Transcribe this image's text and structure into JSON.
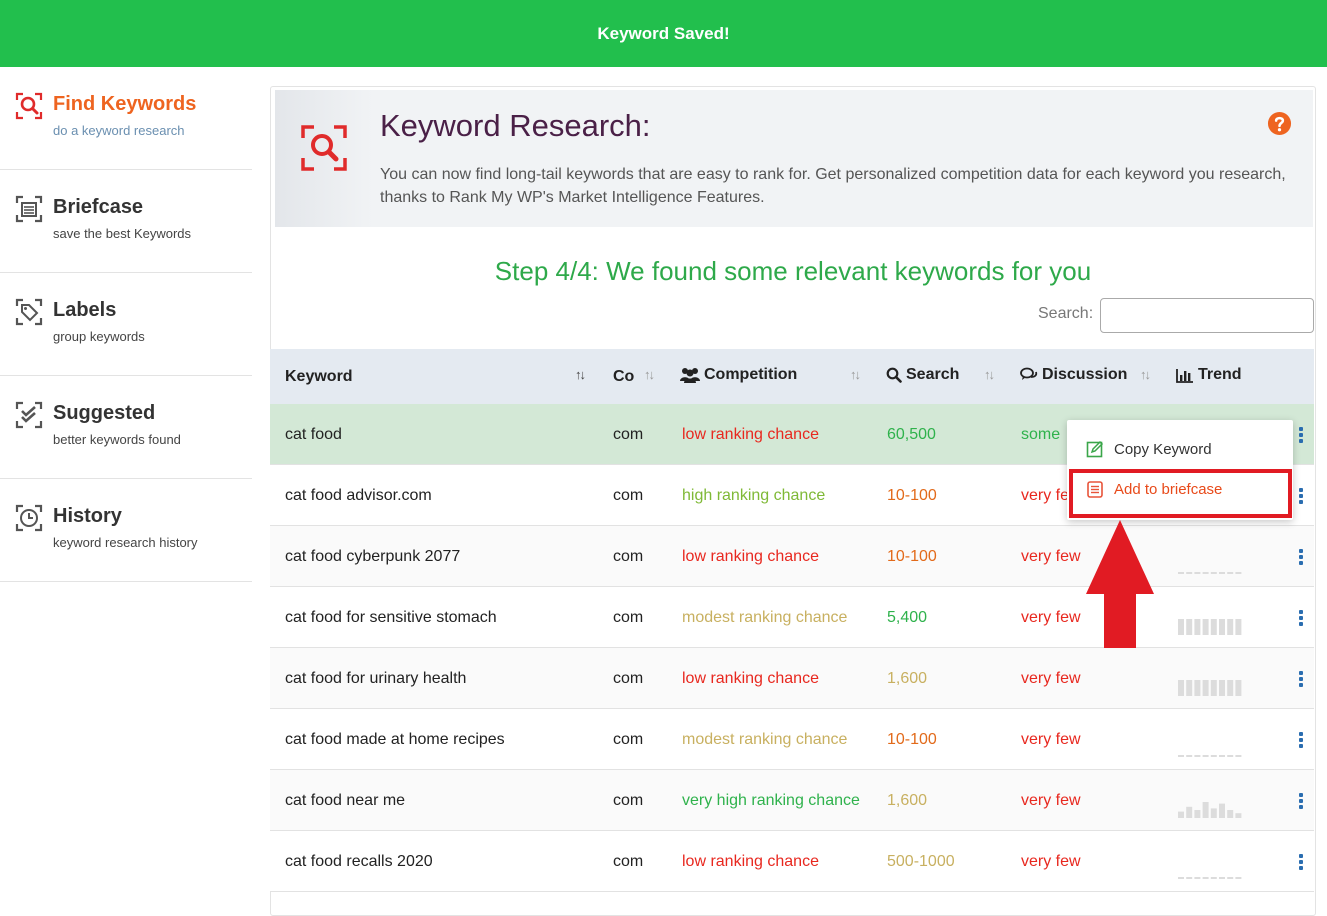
{
  "banner": {
    "text": "Keyword Saved!"
  },
  "sidebar": {
    "items": [
      {
        "title": "Find Keywords",
        "subtitle": "do a keyword research",
        "icon": "search-icon",
        "active": true
      },
      {
        "title": "Briefcase",
        "subtitle": "save the best Keywords",
        "icon": "briefcase-icon",
        "active": false
      },
      {
        "title": "Labels",
        "subtitle": "group keywords",
        "icon": "tags-icon",
        "active": false
      },
      {
        "title": "Suggested",
        "subtitle": "better keywords found",
        "icon": "check-icon",
        "active": false
      },
      {
        "title": "History",
        "subtitle": "keyword research history",
        "icon": "clock-icon",
        "active": false
      }
    ]
  },
  "header": {
    "title": "Keyword Research:",
    "description": "You can now find long-tail keywords that are easy to rank for. Get personalized competition data for each keyword you research, thanks to Rank My WP's Market Intelligence Features."
  },
  "step": {
    "title": "Step 4/4: We found some relevant keywords for you"
  },
  "search": {
    "label": "Search:",
    "value": ""
  },
  "table": {
    "columns": {
      "keyword": "Keyword",
      "country": "Co",
      "competition": "Competition",
      "search": "Search",
      "discussion": "Discussion",
      "trend": "Trend"
    },
    "rows": [
      {
        "keyword": "cat food",
        "country": "com",
        "competition": "low ranking chance",
        "comp_level": "red",
        "search": "60,500",
        "search_level": "green",
        "discussion": "some",
        "disc_level": "green",
        "trend": []
      },
      {
        "keyword": "cat food advisor.com",
        "country": "com",
        "competition": "high ranking chance",
        "comp_level": "lime",
        "search": "10-100",
        "search_level": "orange",
        "discussion": "very few",
        "disc_level": "red",
        "trend": []
      },
      {
        "keyword": "cat food cyberpunk 2077",
        "country": "com",
        "competition": "low ranking chance",
        "comp_level": "red",
        "search": "10-100",
        "search_level": "orange",
        "discussion": "very few",
        "disc_level": "red",
        "trend": [
          0,
          0,
          0,
          0,
          0,
          0,
          0,
          0
        ]
      },
      {
        "keyword": "cat food for sensitive stomach",
        "country": "com",
        "competition": "modest ranking chance",
        "comp_level": "olive",
        "search": "5,400",
        "search_level": "green",
        "discussion": "very few",
        "disc_level": "red",
        "trend": [
          1,
          1,
          1,
          1,
          1,
          1,
          1,
          1
        ]
      },
      {
        "keyword": "cat food for urinary health",
        "country": "com",
        "competition": "low ranking chance",
        "comp_level": "red",
        "search": "1,600",
        "search_level": "olive",
        "discussion": "very few",
        "disc_level": "red",
        "trend": [
          1,
          1,
          1,
          1,
          1,
          1,
          1,
          1
        ]
      },
      {
        "keyword": "cat food made at home recipes",
        "country": "com",
        "competition": "modest ranking chance",
        "comp_level": "olive",
        "search": "10-100",
        "search_level": "orange",
        "discussion": "very few",
        "disc_level": "red",
        "trend": [
          0,
          0,
          0,
          0,
          0,
          0,
          0,
          0
        ]
      },
      {
        "keyword": "cat food near me",
        "country": "com",
        "competition": "very high ranking chance",
        "comp_level": "green",
        "search": "1,600",
        "search_level": "olive",
        "discussion": "very few",
        "disc_level": "red",
        "trend": [
          0.4,
          0.7,
          0.5,
          1,
          0.6,
          0.9,
          0.5,
          0.3
        ]
      },
      {
        "keyword": "cat food recalls 2020",
        "country": "com",
        "competition": "low ranking chance",
        "comp_level": "red",
        "search": "500-1000",
        "search_level": "olive",
        "discussion": "very few",
        "disc_level": "red",
        "trend": [
          0,
          0,
          0,
          0,
          0,
          0,
          0,
          0
        ]
      }
    ]
  },
  "popup": {
    "copy_label": "Copy Keyword",
    "add_label": "Add to briefcase"
  },
  "colors": {
    "banner": "#22bf4d",
    "accent": "#ee6420",
    "highlight": "#e11b23",
    "selected_row": "#d3e8d6"
  }
}
